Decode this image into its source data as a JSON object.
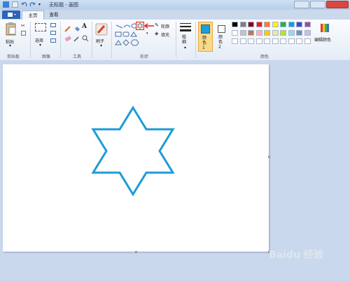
{
  "window": {
    "title": "无标题 - 画图"
  },
  "tabs": [
    {
      "label": "主页"
    },
    {
      "label": "查看"
    }
  ],
  "ribbon": {
    "clipboard": {
      "paste_label": "粘贴",
      "group_label": "剪贴板"
    },
    "image": {
      "select_label": "选择",
      "group_label": "图像"
    },
    "tools": {
      "group_label": "工具"
    },
    "brushes": {
      "label": "刷子"
    },
    "shapes": {
      "outline_label": "轮廓",
      "fill_label": "填充",
      "group_label": "形状"
    },
    "size": {
      "label": "粗细"
    },
    "color1": {
      "label": "颜色 1",
      "color": "#1aa0e0"
    },
    "color2": {
      "label": "颜色 2",
      "color": "#ffffff"
    },
    "colors": {
      "group_label": "颜色",
      "edit_label": "编辑颜色",
      "palette": [
        "#000000",
        "#7f7f7f",
        "#880015",
        "#ed1c24",
        "#ff7f27",
        "#fff200",
        "#22b14c",
        "#00a2e8",
        "#3f48cc",
        "#a349a4",
        "#ffffff",
        "#c3c3c3",
        "#b97a57",
        "#ffaec9",
        "#ffc90e",
        "#efe4b0",
        "#b5e61d",
        "#99d9ea",
        "#7092be",
        "#c8bfe7"
      ]
    },
    "selected_shape": "hexagram-shape"
  },
  "canvas": {
    "shape": "six-pointed-star",
    "stroke_color": "#1d9bd8"
  },
  "watermark": "Baidu 经验"
}
